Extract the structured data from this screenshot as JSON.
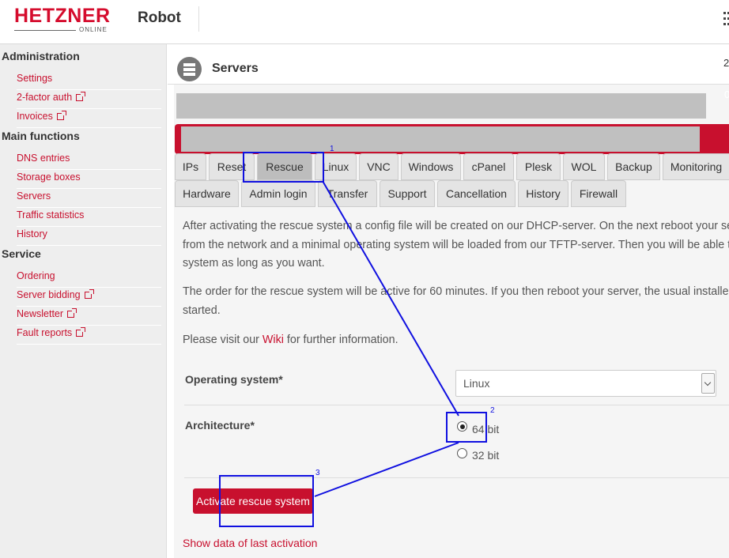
{
  "header": {
    "logo_text": "HETZNER",
    "logo_sub": "ONLINE",
    "app_name": "Robot"
  },
  "sidebar": {
    "sections": [
      {
        "title": "Administration",
        "items": [
          {
            "label": "Settings",
            "external": false
          },
          {
            "label": "2-factor auth",
            "external": true
          },
          {
            "label": "Invoices",
            "external": true
          }
        ]
      },
      {
        "title": "Main functions",
        "items": [
          {
            "label": "DNS entries",
            "external": false
          },
          {
            "label": "Storage boxes",
            "external": false
          },
          {
            "label": "Servers",
            "external": false
          },
          {
            "label": "Traffic statistics",
            "external": false
          },
          {
            "label": "History",
            "external": false
          }
        ]
      },
      {
        "title": "Service",
        "items": [
          {
            "label": "Ordering",
            "external": false
          },
          {
            "label": "Server bidding",
            "external": true
          },
          {
            "label": "Newsletter",
            "external": true
          },
          {
            "label": "Fault reports",
            "external": true
          }
        ]
      }
    ]
  },
  "main": {
    "title": "Servers",
    "row1_number": "2",
    "row2_number": "0",
    "tabs_row1": [
      "IPs",
      "Reset",
      "Rescue",
      "Linux",
      "VNC",
      "Windows",
      "cPanel",
      "Plesk",
      "WOL",
      "Backup",
      "Monitoring"
    ],
    "tabs_row2": [
      "Hardware",
      "Admin login",
      "Transfer",
      "Support",
      "Cancellation",
      "History",
      "Firewall"
    ],
    "active_tab": "Rescue",
    "para1": [
      "After activating the rescue system a config file will be created on our DHCP-server. On the next reboot your se",
      "from the network and a minimal operating system will be loaded from our TFTP-server. Then you will be able to",
      "system as long as you want."
    ],
    "para2": [
      "The order for the rescue system will be active for 60 minutes. If you then reboot your server, the usual installed",
      "started."
    ],
    "para3_prefix": "Please visit our ",
    "para3_link": "Wiki",
    "para3_suffix": " for further information.",
    "form": {
      "os_label": "Operating system*",
      "os_value": "Linux",
      "arch_label": "Architecture*",
      "arch_options": [
        "64 bit",
        "32 bit"
      ],
      "arch_selected": "64 bit",
      "submit_label": "Activate rescue system",
      "last_activation_link": "Show data of last activation"
    }
  },
  "annotations": {
    "color": "#1010e0",
    "labels": [
      "1",
      "2",
      "3"
    ]
  },
  "colors": {
    "brand": "#d50c2d",
    "link": "#c8102e",
    "active_tab": "#bdbdbd"
  }
}
